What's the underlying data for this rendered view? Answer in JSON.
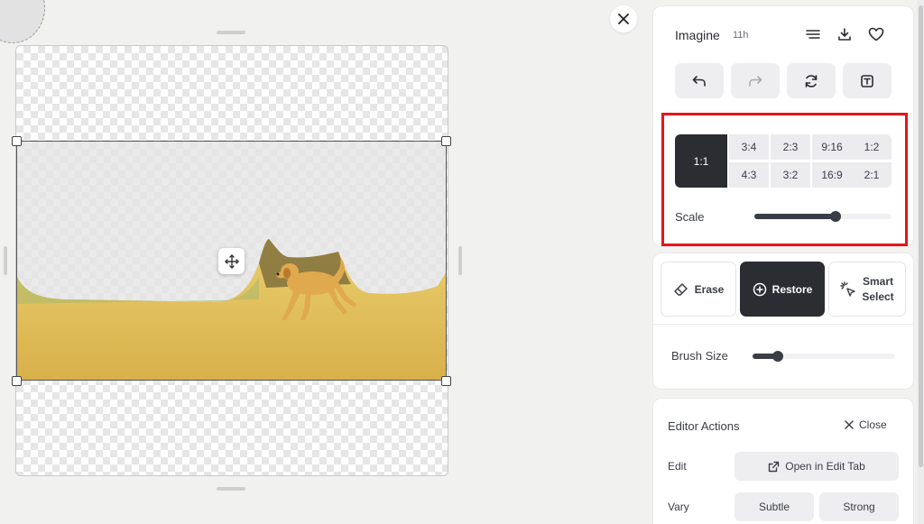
{
  "header": {
    "title": "Imagine",
    "time": "11h",
    "icons": [
      "menu-lines-icon",
      "download-icon",
      "heart-icon"
    ]
  },
  "toolbar": {
    "buttons": [
      "undo-icon",
      "redo-icon",
      "refresh-icon",
      "text-box-icon"
    ]
  },
  "aspect": {
    "selected": "1:1",
    "options": [
      "3:4",
      "2:3",
      "9:16",
      "1:2",
      "4:3",
      "3:2",
      "16:9",
      "2:1"
    ]
  },
  "scale": {
    "label": "Scale",
    "value": 0.59
  },
  "mode": {
    "erase": "Erase",
    "restore": "Restore",
    "smart_line1": "Smart",
    "smart_line2": "Select",
    "active": "Restore"
  },
  "brush": {
    "label": "Brush Size",
    "value": 0.18
  },
  "editor_actions": {
    "title": "Editor Actions",
    "close_label": "Close",
    "edit_label": "Edit",
    "open_tab_label": "Open in Edit Tab",
    "vary_label": "Vary",
    "subtle_label": "Subtle",
    "strong_label": "Strong"
  },
  "colors": {
    "dark": "#2b2d33",
    "highlight": "#e4161b",
    "field": "#e8c45a"
  }
}
